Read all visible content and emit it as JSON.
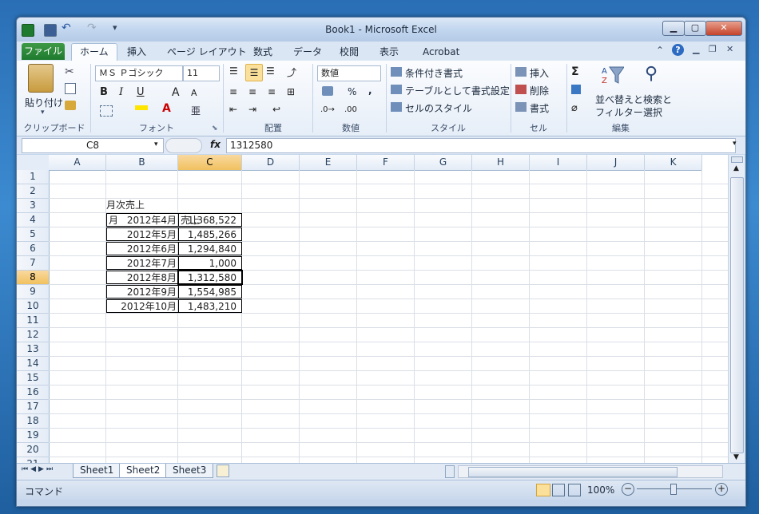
{
  "window": {
    "title": "Book1  -  Microsoft Excel"
  },
  "tabs": [
    "ファイル",
    "ホーム",
    "挿入",
    "ページ レイアウト",
    "数式",
    "データ",
    "校閲",
    "表示",
    "Acrobat"
  ],
  "ribbon": {
    "clipboard": {
      "paste": "貼り付け",
      "label": "クリップボード"
    },
    "font": {
      "name": "ＭＳ Ｐゴシック",
      "size": "11",
      "label": "フォント"
    },
    "alignment": {
      "label": "配置"
    },
    "number": {
      "format": "数値",
      "percent": "%",
      "comma": ",",
      "label": "数値"
    },
    "styles": {
      "conditional": "条件付き書式",
      "table": "テーブルとして書式設定",
      "cell": "セルのスタイル",
      "label": "スタイル"
    },
    "cells": {
      "insert": "挿入",
      "delete": "削除",
      "format": "書式",
      "label": "セル"
    },
    "editing": {
      "sort1": "並べ替えと",
      "sort2": "フィルター",
      "find1": "検索と",
      "find2": "選択",
      "sigma": "Σ",
      "label": "編集"
    }
  },
  "formula_bar": {
    "name_box": "C8",
    "fx": "fx",
    "value": "1312580"
  },
  "columns": [
    "A",
    "B",
    "C",
    "D",
    "E",
    "F",
    "G",
    "H",
    "I",
    "J",
    "K"
  ],
  "rows": [
    "1",
    "2",
    "3",
    "4",
    "5",
    "6",
    "7",
    "8",
    "9",
    "10",
    "11",
    "12",
    "13",
    "14",
    "15",
    "16",
    "17",
    "18",
    "19",
    "20",
    "21"
  ],
  "sheet": {
    "title": "月次売上",
    "headers": [
      "月",
      "売上"
    ],
    "data": [
      {
        "month": "2012年4月",
        "sales": "1,368,522"
      },
      {
        "month": "2012年5月",
        "sales": "1,485,266"
      },
      {
        "month": "2012年6月",
        "sales": "1,294,840"
      },
      {
        "month": "2012年7月",
        "sales": "1,000"
      },
      {
        "month": "2012年8月",
        "sales": "1,312,580"
      },
      {
        "month": "2012年9月",
        "sales": "1,554,985"
      },
      {
        "month": "2012年10月",
        "sales": "1,483,210"
      }
    ]
  },
  "sheet_tabs": [
    "Sheet1",
    "Sheet2",
    "Sheet3"
  ],
  "status": {
    "mode": "コマンド",
    "zoom": "100%"
  },
  "colors": {
    "file_tab": "#1e7a2e",
    "selected_header": "#f1c15f"
  }
}
